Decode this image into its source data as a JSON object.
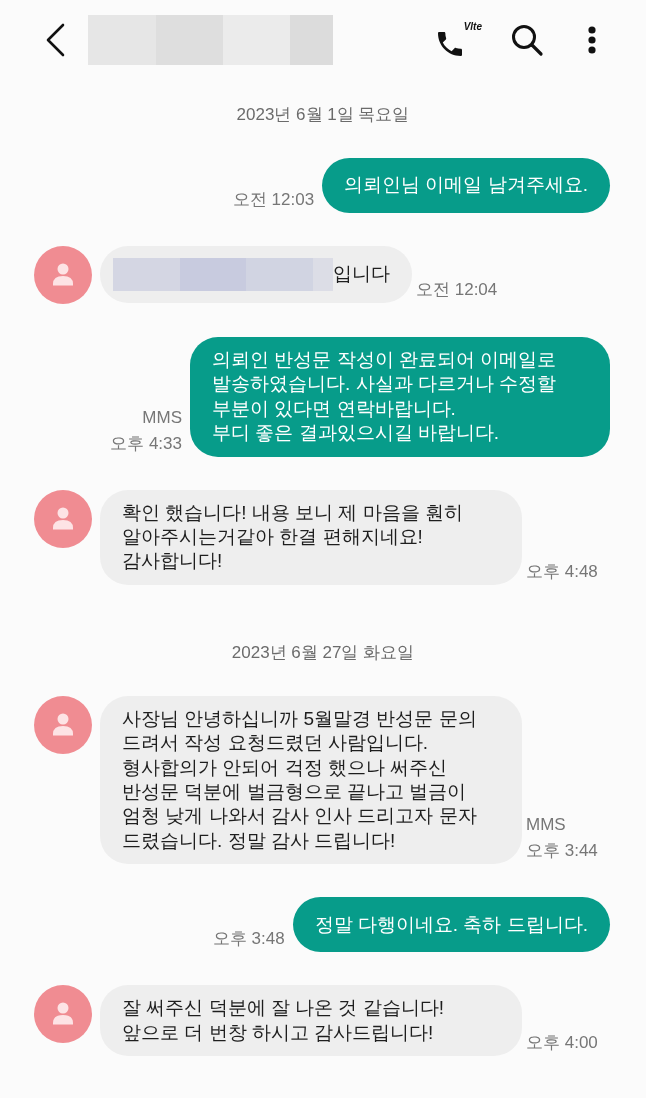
{
  "header": {
    "call_badge": "Vlte"
  },
  "messages": [
    {
      "kind": "date",
      "text": "2023년 6월 1일 목요일"
    },
    {
      "kind": "sent",
      "text": "의뢰인님 이메일 남겨주세요.",
      "time": "오전 12:03"
    },
    {
      "kind": "received",
      "redacted_prefix": true,
      "text": "입니다",
      "time": "오전 12:04"
    },
    {
      "kind": "sent",
      "text": "의뢰인 반성문 작성이 완료되어 이메일로\n발송하였습니다. 사실과 다르거나 수정할\n부분이 있다면 연락바랍니다.\n부디 좋은 결과있으시길 바랍니다.",
      "label": "MMS",
      "time": "오후 4:33"
    },
    {
      "kind": "received",
      "text": "확인 했습니다! 내용 보니 제 마음을 훤히\n알아주시는거같아 한결 편해지네요!\n감사합니다!",
      "time": "오후 4:48"
    },
    {
      "kind": "date",
      "text": "2023년 6월 27일 화요일"
    },
    {
      "kind": "received",
      "text": "사장님 안녕하십니까 5월말경 반성문 문의\n드려서 작성 요청드렸던 사람입니다.\n형사합의가 안되어 걱정 했으나 써주신\n반성문 덕분에 벌금형으로 끝나고 벌금이\n엄청 낮게 나와서 감사 인사 드리고자 문자\n드렸습니다. 정말 감사 드립니다!",
      "label": "MMS",
      "time": "오후 3:44"
    },
    {
      "kind": "sent",
      "text": "정말 다행이네요. 축하 드립니다.",
      "time": "오후 3:48"
    },
    {
      "kind": "received",
      "text": "잘 써주신 덕분에 잘 나온 것 같습니다!\n앞으로 더 번창 하시고 감사드립니다!",
      "time": "오후 4:00"
    }
  ]
}
